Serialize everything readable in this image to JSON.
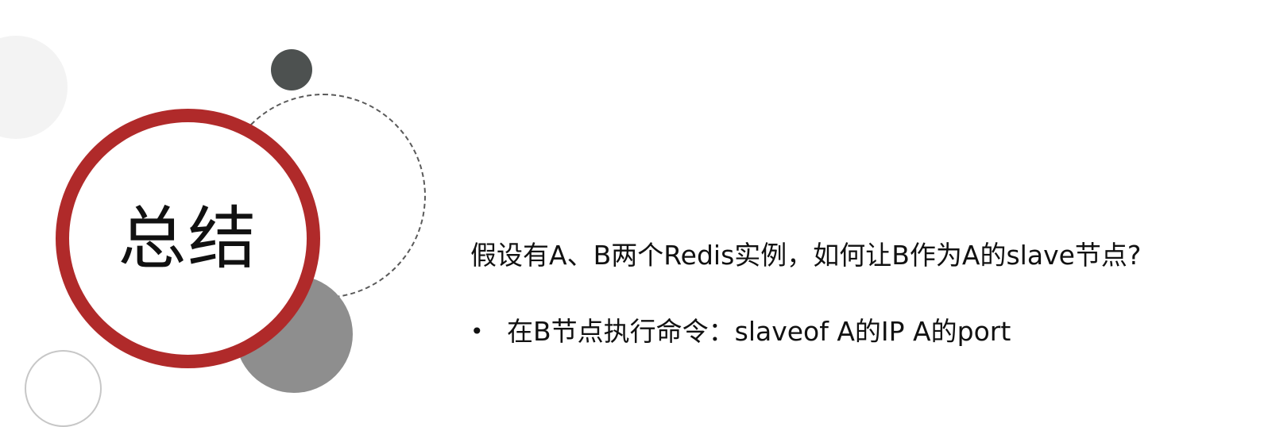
{
  "title": "总结",
  "question": "假设有A、B两个Redis实例，如何让B作为A的slave节点?",
  "bullets": [
    {
      "marker": "•",
      "text": "在B节点执行命令：slaveof A的IP A的port"
    }
  ],
  "colors": {
    "accent_red": "#b02a2a",
    "dark_gray": "#4d5150",
    "mid_gray": "#8e8e8e",
    "light_gray": "#f3f3f3"
  }
}
